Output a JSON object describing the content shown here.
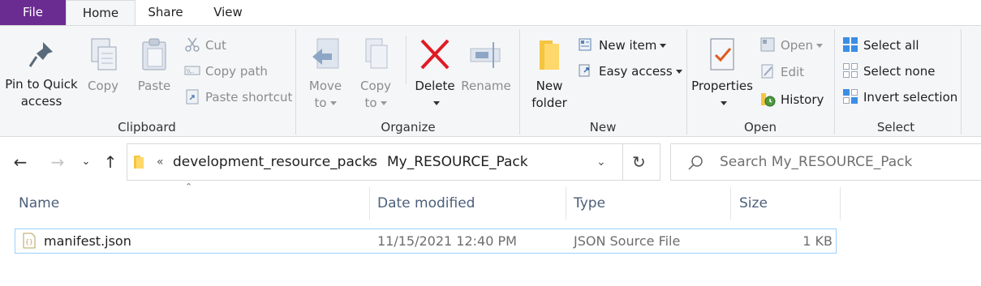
{
  "tabs": {
    "file": "File",
    "home": "Home",
    "share": "Share",
    "view": "View"
  },
  "clipboard": {
    "pin_label_1": "Pin to Quick",
    "pin_label_2": "access",
    "copy": "Copy",
    "paste": "Paste",
    "cut": "Cut",
    "copy_path": "Copy path",
    "paste_shortcut": "Paste shortcut",
    "group": "Clipboard"
  },
  "organize": {
    "move_to_1": "Move",
    "move_to_2": "to",
    "copy_to_1": "Copy",
    "copy_to_2": "to",
    "delete": "Delete",
    "rename": "Rename",
    "group": "Organize"
  },
  "new": {
    "new_folder_1": "New",
    "new_folder_2": "folder",
    "new_item": "New item",
    "easy_access": "Easy access",
    "group": "New"
  },
  "open": {
    "properties": "Properties",
    "open": "Open",
    "edit": "Edit",
    "history": "History",
    "group": "Open"
  },
  "select": {
    "select_all": "Select all",
    "select_none": "Select none",
    "invert": "Invert selection",
    "group": "Select"
  },
  "address": {
    "overflow": "«",
    "crumbs": [
      "development_resource_packs",
      "My_RESOURCE_Pack"
    ],
    "sep": "›"
  },
  "search": {
    "placeholder": "Search My_RESOURCE_Pack"
  },
  "columns": {
    "name": "Name",
    "date": "Date modified",
    "type": "Type",
    "size": "Size"
  },
  "files": [
    {
      "name": "manifest.json",
      "date": "11/15/2021 12:40 PM",
      "type": "JSON Source File",
      "size": "1 KB"
    }
  ],
  "colors": {
    "file_tab": "#6b2c91",
    "delete_red": "#e01b24",
    "selection_border": "#99d1ff",
    "header_text": "#4c607a"
  }
}
